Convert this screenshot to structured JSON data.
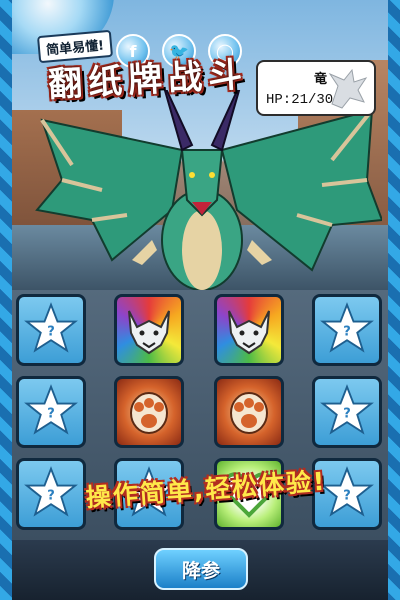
{
  "header": {
    "tag_label": "简单易懂!",
    "title": "翻纸牌战斗",
    "social": [
      {
        "name": "facebook",
        "glyph": "f"
      },
      {
        "name": "twitter",
        "glyph": "🐦"
      },
      {
        "name": "line",
        "glyph": "◯"
      }
    ]
  },
  "enemy": {
    "name": "竜",
    "hp_text": "HP:21/30"
  },
  "board": {
    "cards": [
      {
        "id": "r1c1",
        "state": "hidden",
        "icon": "question-star-icon",
        "glyph": "?"
      },
      {
        "id": "r1c2",
        "state": "revealed",
        "icon": "wolf-face-icon"
      },
      {
        "id": "r1c3",
        "state": "revealed",
        "icon": "wolf-face-icon"
      },
      {
        "id": "r1c4",
        "state": "hidden",
        "icon": "question-star-icon",
        "glyph": "?"
      },
      {
        "id": "r2c1",
        "state": "hidden",
        "icon": "question-star-icon",
        "glyph": "?"
      },
      {
        "id": "r2c2",
        "state": "revealed",
        "icon": "paw-icon"
      },
      {
        "id": "r2c3",
        "state": "revealed",
        "icon": "paw-icon"
      },
      {
        "id": "r2c4",
        "state": "hidden",
        "icon": "question-star-icon",
        "glyph": "?"
      },
      {
        "id": "r3c1",
        "state": "hidden",
        "icon": "question-star-icon",
        "glyph": "?"
      },
      {
        "id": "r3c2",
        "state": "hidden",
        "icon": "question-star-icon",
        "glyph": "?"
      },
      {
        "id": "r3c3",
        "state": "revealed",
        "icon": "heart-icon"
      },
      {
        "id": "r3c4",
        "state": "hidden",
        "icon": "question-star-icon",
        "glyph": "?"
      }
    ]
  },
  "slogan": "操作简单,轻松体验!",
  "actions": {
    "surrender_label": "降参"
  },
  "colors": {
    "frame": "#1b8fd0",
    "title_outline": "#b22d20",
    "slogan": "#ffe94a",
    "button": "#1b80c8"
  }
}
